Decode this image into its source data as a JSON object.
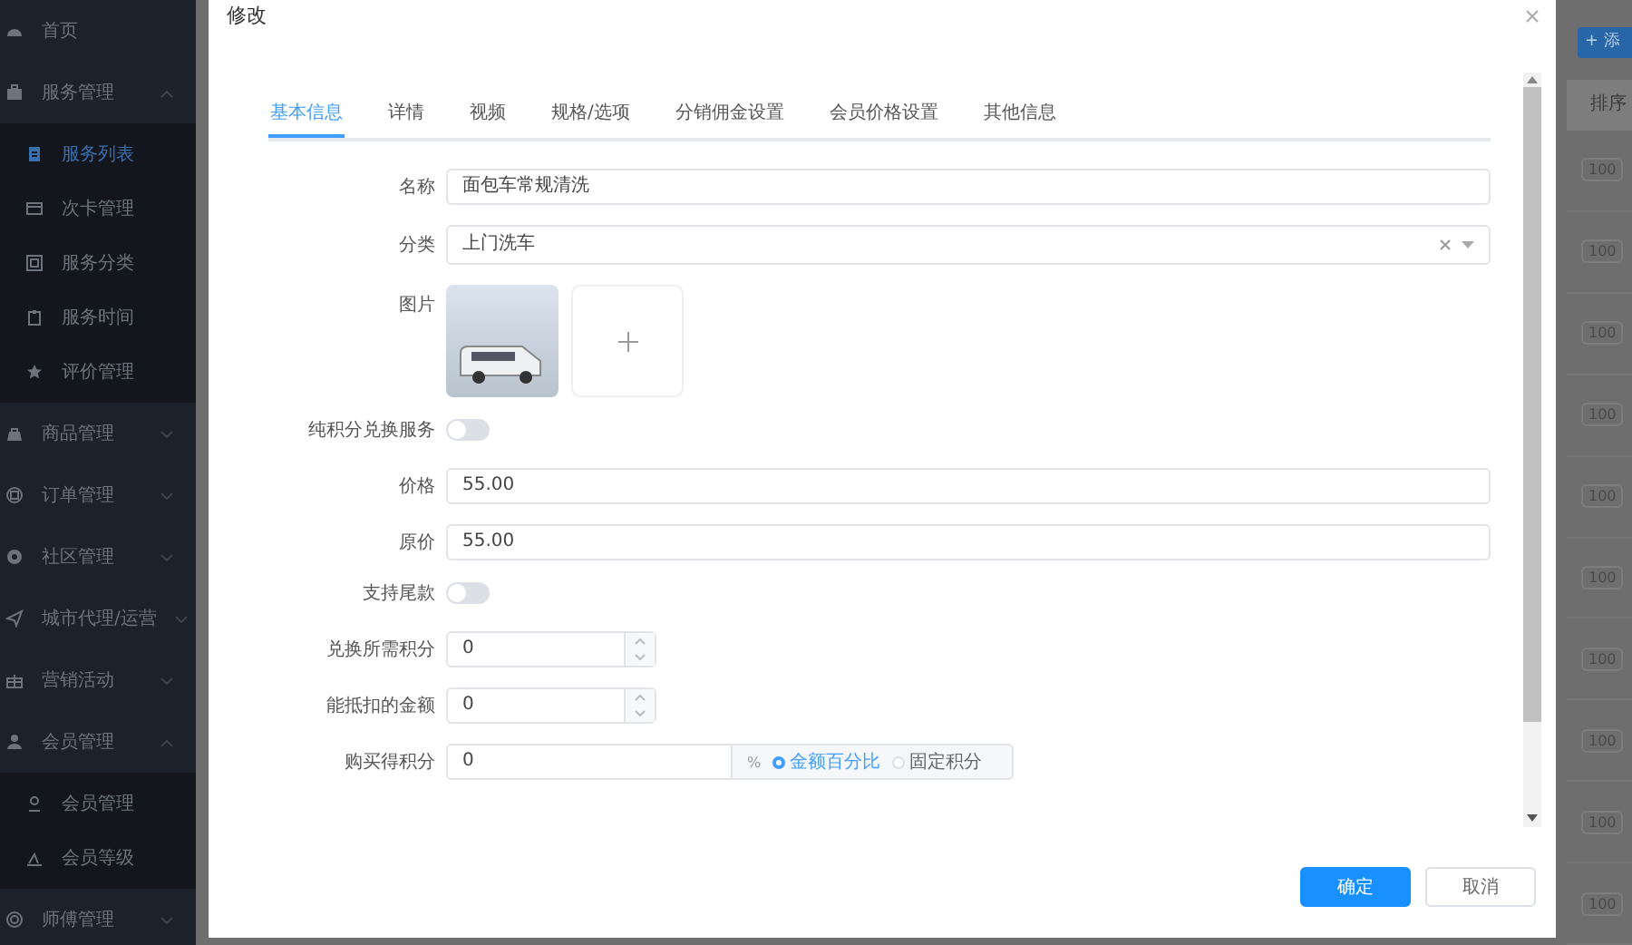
{
  "sidebar": {
    "items": [
      {
        "label": "首页",
        "has_children": false
      },
      {
        "label": "服务管理",
        "expanded": true,
        "has_children": true,
        "children": [
          {
            "label": "服务列表",
            "selected": true
          },
          {
            "label": "次卡管理",
            "selected": false
          },
          {
            "label": "服务分类",
            "selected": false
          },
          {
            "label": "服务时间",
            "selected": false
          },
          {
            "label": "评价管理",
            "selected": false
          }
        ]
      },
      {
        "label": "商品管理",
        "expanded": false,
        "has_children": true
      },
      {
        "label": "订单管理",
        "expanded": false,
        "has_children": true
      },
      {
        "label": "社区管理",
        "expanded": false,
        "has_children": true
      },
      {
        "label": "城市代理/运营",
        "expanded": false,
        "has_children": true
      },
      {
        "label": "营销活动",
        "expanded": false,
        "has_children": true
      },
      {
        "label": "会员管理",
        "expanded": true,
        "has_children": true,
        "children": [
          {
            "label": "会员管理",
            "selected": false
          },
          {
            "label": "会员等级",
            "selected": false
          }
        ]
      },
      {
        "label": "师傅管理",
        "expanded": false,
        "has_children": true
      }
    ]
  },
  "background_table": {
    "add_button": "+ 添",
    "column": "排序",
    "rows": [
      "100",
      "100",
      "100",
      "100",
      "100",
      "100",
      "100",
      "100",
      "100",
      "100"
    ]
  },
  "dialog": {
    "title": "修改",
    "tabs": [
      {
        "label": "基本信息",
        "selected": true
      },
      {
        "label": "详情",
        "selected": false
      },
      {
        "label": "视频",
        "selected": false
      },
      {
        "label": "规格/选项",
        "selected": false
      },
      {
        "label": "分销佣金设置",
        "selected": false
      },
      {
        "label": "会员价格设置",
        "selected": false
      },
      {
        "label": "其他信息",
        "selected": false
      }
    ],
    "fields": [
      {
        "kind": "text",
        "label": "名称",
        "value": "面包车常规清洗"
      },
      {
        "kind": "select",
        "label": "分类",
        "value": "上门洗车"
      },
      {
        "kind": "images",
        "label": "图片"
      },
      {
        "kind": "switch",
        "label": "纯积分兑换服务",
        "on": false
      },
      {
        "kind": "text",
        "label": "价格",
        "value": "55.00"
      },
      {
        "kind": "text",
        "label": "原价",
        "value": "55.00"
      },
      {
        "kind": "switch",
        "label": "支持尾款",
        "on": false
      },
      {
        "kind": "number",
        "label": "兑换所需积分",
        "value": "0"
      },
      {
        "kind": "number",
        "label": "能抵扣的金额",
        "value": "0"
      },
      {
        "kind": "points",
        "label": "购买得积分",
        "value": "0",
        "unit": "%",
        "options": [
          {
            "label": "金额百分比",
            "selected": true
          },
          {
            "label": "固定积分",
            "selected": false
          }
        ]
      }
    ],
    "buttons": [
      {
        "label": "确定",
        "kind": "primary"
      },
      {
        "label": "取消",
        "kind": "default"
      }
    ]
  }
}
